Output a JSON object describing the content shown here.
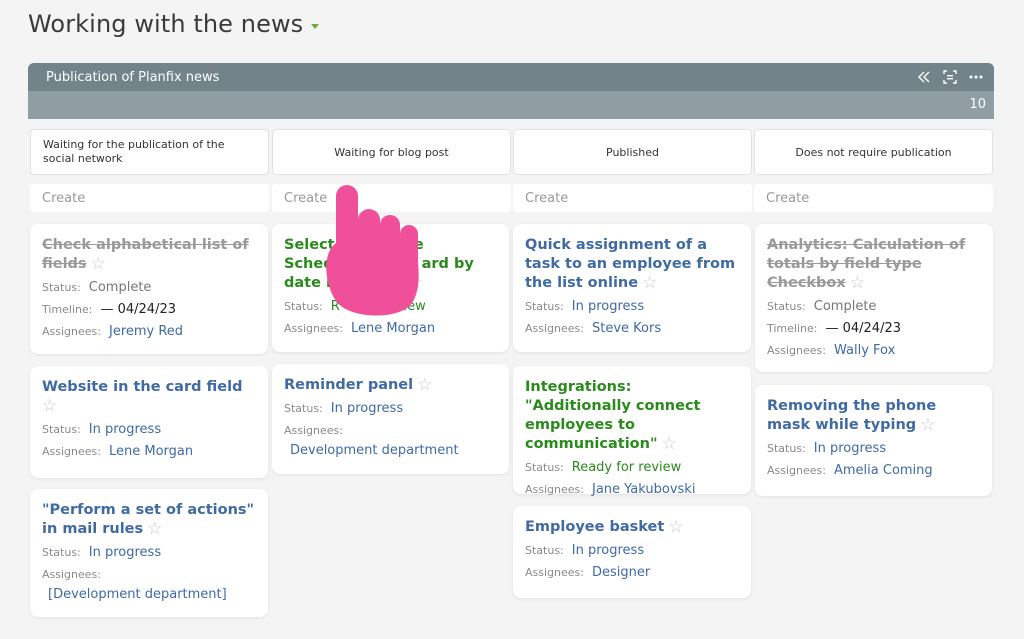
{
  "page": {
    "title": "Working with the news"
  },
  "board": {
    "name": "Publication of Planfix news",
    "count": "10",
    "tools": [
      "collapse-icon",
      "focus-icon",
      "more-icon"
    ]
  },
  "columns": [
    {
      "title": "Waiting for the publication of the social network",
      "create_label": "Create"
    },
    {
      "title": "Waiting for blog post",
      "create_label": "Create"
    },
    {
      "title": "Published",
      "create_label": "Create"
    },
    {
      "title": "Does not require publication",
      "create_label": "Create"
    }
  ],
  "labels": {
    "status": "Status:",
    "timeline": "Timeline:",
    "assignees": "Assignees:"
  },
  "cards": {
    "c1": {
      "title": "Check alphabetical list of fields",
      "status": "Complete",
      "timeline": "— 04/24/23",
      "assignees": "Jeremy Red"
    },
    "c2": {
      "title": "Website in the card field",
      "status": "In progress",
      "assignees": "Lene Morgan"
    },
    "c3": {
      "title": "\"Perform a set of actions\" in mail rules",
      "status": "In progress",
      "assignees": "[Development department]"
    },
    "c4": {
      "title_line1": "Select",
      "title_line1b": "the",
      "title_line2": "Sched",
      "title_line2b": "ard by",
      "title_line3": "date i",
      "status": "R",
      "status_end": "view",
      "assignees": "Lene Morgan"
    },
    "c5": {
      "title": "Reminder panel",
      "status": "In progress",
      "assignees": "Development department"
    },
    "c6": {
      "title": "Quick assignment of a task to an employee from the list online",
      "status": "In progress",
      "assignees": "Steve Kors"
    },
    "c7": {
      "title": "Integrations: \"Additionally connect employees to communication\"",
      "status": "Ready for review",
      "assignees": "Jane Yakubovski"
    },
    "c8": {
      "title": "Employee basket",
      "status": "In progress",
      "assignees": "Designer"
    },
    "c9": {
      "title": "Analytics: Calculation of totals by field type Checkbox",
      "status": "Complete",
      "timeline": "— 04/24/23",
      "assignees": "Wally Fox"
    },
    "c10": {
      "title": "Removing the phone mask while typing",
      "status": "In progress",
      "assignees": "Amelia Coming"
    }
  },
  "colors": {
    "accent": "#3f6aa3",
    "green": "#2a8a1c",
    "header": "#728489",
    "pointer": "#f0509a"
  }
}
